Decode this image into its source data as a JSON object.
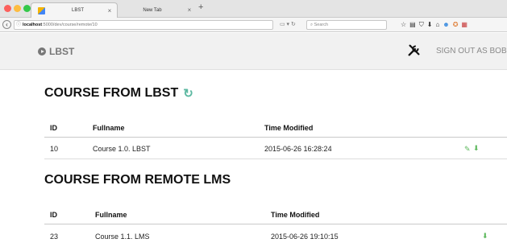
{
  "browser": {
    "tabs": [
      {
        "title": "LBST",
        "close": "×"
      },
      {
        "title": "New Tab",
        "close": "×"
      }
    ],
    "new_tab": "+",
    "url_host": "localhost",
    "url_path": ":5000/dev/course/remote/10",
    "search_placeholder": "Search"
  },
  "header": {
    "brand": "LBST",
    "signout": "SIGN OUT AS BOB"
  },
  "sections": [
    {
      "title": "COURSE FROM LBST",
      "columns": [
        "ID",
        "Fullname",
        "Time Modified"
      ],
      "rows": [
        {
          "id": "10",
          "fullname": "Course 1.0. LBST",
          "time_modified": "2015-06-26 16:28:24"
        }
      ]
    },
    {
      "title": "COURSE FROM REMOTE LMS",
      "columns": [
        "ID",
        "Fullname",
        "Time Modified"
      ],
      "rows": [
        {
          "id": "23",
          "fullname": "Course 1.1. LMS",
          "time_modified": "2015-06-26 19:10:15"
        }
      ]
    }
  ],
  "colors": {
    "accent": "#5cb85c",
    "refresh": "#5cb8a1"
  }
}
